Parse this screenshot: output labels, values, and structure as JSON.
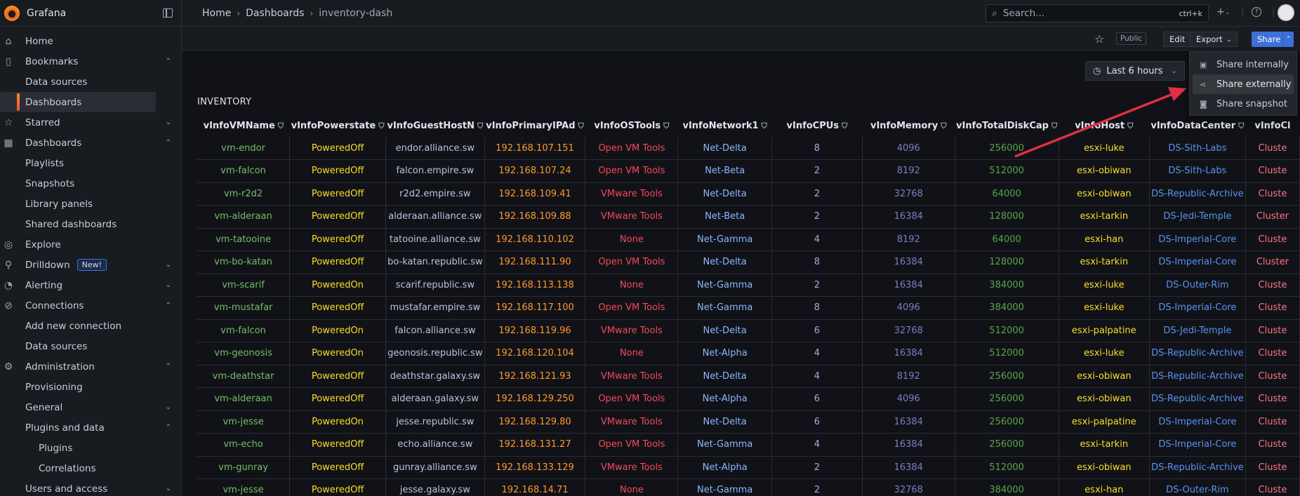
{
  "app": {
    "name": "Grafana"
  },
  "sidebar": {
    "items": [
      {
        "label": "Home",
        "icon": "home-icon"
      },
      {
        "label": "Bookmarks",
        "icon": "bookmark-icon",
        "chev": "⌃"
      },
      {
        "label": "Data sources",
        "sub": true
      },
      {
        "label": "Dashboards",
        "sub": true,
        "active": true
      },
      {
        "label": "Starred",
        "icon": "star-icon",
        "chev": "⌄"
      },
      {
        "label": "Dashboards",
        "icon": "dashboards-icon",
        "chev": "⌃"
      },
      {
        "label": "Playlists",
        "sub": true
      },
      {
        "label": "Snapshots",
        "sub": true
      },
      {
        "label": "Library panels",
        "sub": true
      },
      {
        "label": "Shared dashboards",
        "sub": true
      },
      {
        "label": "Explore",
        "icon": "compass-icon"
      },
      {
        "label": "Drilldown",
        "icon": "drilldown-icon",
        "badge": "New!",
        "chev": "⌄"
      },
      {
        "label": "Alerting",
        "icon": "bell-icon",
        "chev": "⌄"
      },
      {
        "label": "Connections",
        "icon": "connections-icon",
        "chev": "⌃"
      },
      {
        "label": "Add new connection",
        "sub": true
      },
      {
        "label": "Data sources",
        "sub": true
      },
      {
        "label": "Administration",
        "icon": "gear-icon",
        "chev": "⌃"
      },
      {
        "label": "Provisioning",
        "sub": true
      },
      {
        "label": "General",
        "sub": true,
        "chev": "⌄"
      },
      {
        "label": "Plugins and data",
        "sub": true,
        "chev": "⌃"
      },
      {
        "label": "Plugins",
        "sub2": true
      },
      {
        "label": "Correlations",
        "sub2": true
      },
      {
        "label": "Users and access",
        "sub": true,
        "chev": "⌄"
      }
    ]
  },
  "topbar": {
    "breadcrumb": [
      "Home",
      "Dashboards",
      "inventory-dash"
    ],
    "search_placeholder": "Search...",
    "search_shortcut": "ctrl+k",
    "add_label": "+"
  },
  "toolbar": {
    "public_label": "Public",
    "edit_label": "Edit",
    "export_label": "Export",
    "share_label": "Share"
  },
  "timepicker": {
    "label": "Last 6 hours"
  },
  "share_menu": {
    "items": [
      {
        "label": "Share internally",
        "icon": "dashboard-icon"
      },
      {
        "label": "Share externally",
        "icon": "share-nodes-icon",
        "hover": true
      },
      {
        "label": "Share snapshot",
        "icon": "camera-icon"
      }
    ]
  },
  "panel": {
    "title": "INVENTORY",
    "columns": [
      "vInfoVMName",
      "vInfoPowerstate",
      "vInfoGuestHostName",
      "vInfoPrimaryIPAddress",
      "vInfoOSTools",
      "vInfoNetwork1",
      "vInfoCPUs",
      "vInfoMemory",
      "vInfoTotalDiskCapacity",
      "vInfoHost",
      "vInfoDataCenter",
      "vInfoCluster"
    ],
    "column_display": [
      "vInfoVMName",
      "vInfoPowerstate",
      "vInfoGuestHostN",
      "vInfoPrimaryIPAd",
      "vInfoOSTools",
      "vInfoNetwork1",
      "vInfoCPUs",
      "vInfoMemory",
      "vInfoTotalDiskCap",
      "vInfoHost",
      "vInfoDataCenter",
      "vInfoCl"
    ],
    "rows": [
      [
        "vm-endor",
        "PoweredOff",
        "endor.alliance.sw",
        "192.168.107.151",
        "Open VM Tools",
        "Net-Delta",
        "8",
        "4096",
        "256000",
        "esxi-luke",
        "DS-Sith-Labs",
        "Cluste"
      ],
      [
        "vm-falcon",
        "PoweredOff",
        "falcon.empire.sw",
        "192.168.107.24",
        "Open VM Tools",
        "Net-Beta",
        "2",
        "8192",
        "512000",
        "esxi-obiwan",
        "DS-Sith-Labs",
        "Cluste"
      ],
      [
        "vm-r2d2",
        "PoweredOff",
        "r2d2.empire.sw",
        "192.168.109.41",
        "VMware Tools",
        "Net-Delta",
        "2",
        "32768",
        "64000",
        "esxi-obiwan",
        "DS-Republic-Archive",
        "Cluste"
      ],
      [
        "vm-alderaan",
        "PoweredOff",
        "alderaan.alliance.sw",
        "192.168.109.88",
        "VMware Tools",
        "Net-Beta",
        "2",
        "16384",
        "128000",
        "esxi-tarkin",
        "DS-Jedi-Temple",
        "Cluster"
      ],
      [
        "vm-tatooine",
        "PoweredOff",
        "tatooine.alliance.sw",
        "192.168.110.102",
        "None",
        "Net-Gamma",
        "4",
        "8192",
        "64000",
        "esxi-han",
        "DS-Imperial-Core",
        "Cluste"
      ],
      [
        "vm-bo-katan",
        "PoweredOff",
        "bo-katan.republic.sw",
        "192.168.111.90",
        "Open VM Tools",
        "Net-Delta",
        "8",
        "16384",
        "128000",
        "esxi-tarkin",
        "DS-Imperial-Core",
        "Cluster"
      ],
      [
        "vm-scarif",
        "PoweredOn",
        "scarif.republic.sw",
        "192.168.113.138",
        "None",
        "Net-Gamma",
        "2",
        "16384",
        "384000",
        "esxi-luke",
        "DS-Outer-Rim",
        "Cluste"
      ],
      [
        "vm-mustafar",
        "PoweredOff",
        "mustafar.empire.sw",
        "192.168.117.100",
        "Open VM Tools",
        "Net-Gamma",
        "8",
        "4096",
        "384000",
        "esxi-luke",
        "DS-Imperial-Core",
        "Cluste"
      ],
      [
        "vm-falcon",
        "PoweredOn",
        "falcon.alliance.sw",
        "192.168.119.96",
        "VMware Tools",
        "Net-Delta",
        "6",
        "32768",
        "512000",
        "esxi-palpatine",
        "DS-Jedi-Temple",
        "Cluste"
      ],
      [
        "vm-geonosis",
        "PoweredOn",
        "geonosis.republic.sw",
        "192.168.120.104",
        "None",
        "Net-Alpha",
        "4",
        "16384",
        "512000",
        "esxi-luke",
        "DS-Republic-Archive",
        "Cluste"
      ],
      [
        "vm-deathstar",
        "PoweredOff",
        "deathstar.galaxy.sw",
        "192.168.121.93",
        "VMware Tools",
        "Net-Delta",
        "4",
        "8192",
        "256000",
        "esxi-obiwan",
        "DS-Republic-Archive",
        "Cluste"
      ],
      [
        "vm-alderaan",
        "PoweredOff",
        "alderaan.galaxy.sw",
        "192.168.129.250",
        "Open VM Tools",
        "Net-Alpha",
        "6",
        "4096",
        "256000",
        "esxi-obiwan",
        "DS-Republic-Archive",
        "Cluste"
      ],
      [
        "vm-jesse",
        "PoweredOn",
        "jesse.republic.sw",
        "192.168.129.80",
        "VMware Tools",
        "Net-Delta",
        "6",
        "16384",
        "256000",
        "esxi-palpatine",
        "DS-Imperial-Core",
        "Cluste"
      ],
      [
        "vm-echo",
        "PoweredOff",
        "echo.alliance.sw",
        "192.168.131.27",
        "Open VM Tools",
        "Net-Gamma",
        "4",
        "16384",
        "256000",
        "esxi-tarkin",
        "DS-Imperial-Core",
        "Cluste"
      ],
      [
        "vm-gunray",
        "PoweredOff",
        "gunray.alliance.sw",
        "192.168.133.129",
        "VMware Tools",
        "Net-Alpha",
        "2",
        "16384",
        "512000",
        "esxi-obiwan",
        "DS-Republic-Archive",
        "Cluste"
      ],
      [
        "vm-jesse",
        "PoweredOff",
        "jesse.galaxy.sw",
        "192.168.14.71",
        "None",
        "Net-Gamma",
        "2",
        "32768",
        "384000",
        "esxi-han",
        "DS-Outer-Rim",
        "Cluste"
      ]
    ]
  },
  "colors": {
    "accent": "#3d71d9",
    "name": "#73bf69",
    "powerstate": "#fade2a",
    "ip": "#ff9830",
    "os_tools": "#f2495c",
    "network": "#8ab8ff",
    "annotation_arrow": "#e02f44"
  }
}
